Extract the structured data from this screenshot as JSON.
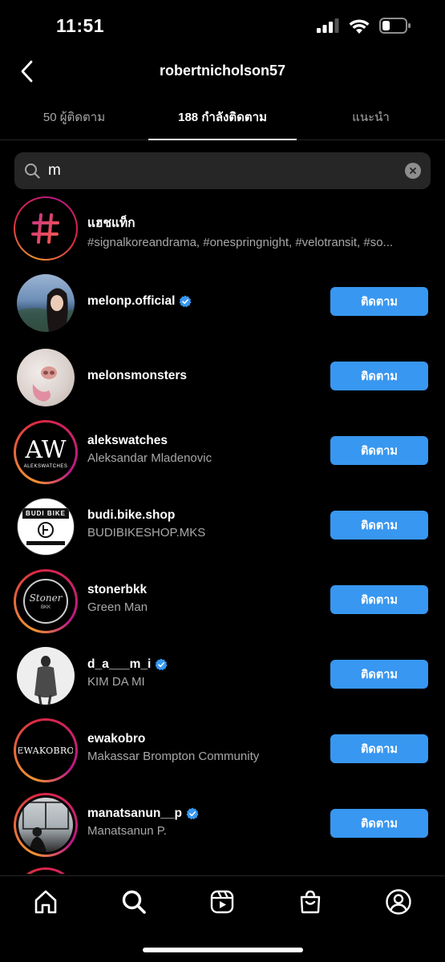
{
  "status_bar": {
    "time": "11:51"
  },
  "header": {
    "title": "robertnicholson57"
  },
  "tabs": [
    {
      "label": "50 ผู้ติดตาม"
    },
    {
      "label": "188 กำลังติดตาม"
    },
    {
      "label": "แนะนำ"
    }
  ],
  "search": {
    "value": "m",
    "icon": "search-icon"
  },
  "hashtag_row": {
    "title": "แฮชแท็ก",
    "subtitle": "#signalkoreandrama, #onespringnight, #velotransit, #so..."
  },
  "follow_label": "ติดตาม",
  "users": [
    {
      "username": "melonp.official",
      "fullname": "",
      "verified": true
    },
    {
      "username": "melonsmonsters",
      "fullname": "",
      "verified": false
    },
    {
      "username": "alekswatches",
      "fullname": "Aleksandar Mladenovic",
      "verified": false,
      "avatar_logo": "AW",
      "avatar_caption": "ALEKSWATCHES"
    },
    {
      "username": "budi.bike.shop",
      "fullname": "BUDIBIKESHOP.MKS",
      "verified": false,
      "avatar_logo": "BUDI BIKE"
    },
    {
      "username": "stonerbkk",
      "fullname": "Green Man",
      "verified": false,
      "avatar_logo": "Stoner",
      "avatar_caption": "BKK"
    },
    {
      "username": "d_a___m_i",
      "fullname": "KIM DA MI",
      "verified": true
    },
    {
      "username": "ewakobro",
      "fullname": "Makassar Brompton Community",
      "verified": false,
      "avatar_logo": "EWAKOBRO"
    },
    {
      "username": "manatsanun__p",
      "fullname": "Manatsanun P.",
      "verified": true
    }
  ],
  "bottom_nav": [
    "home-icon",
    "search-icon",
    "reels-icon",
    "shop-icon",
    "profile-icon"
  ],
  "colors": {
    "accent": "#3897f0",
    "background": "#000000",
    "secondary_text": "#a8a8a8"
  }
}
